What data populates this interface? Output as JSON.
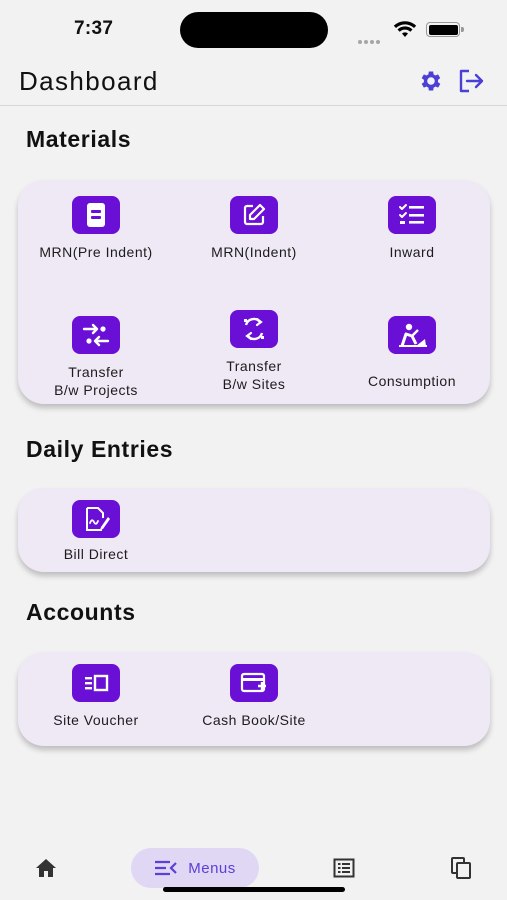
{
  "status_bar": {
    "time": "7:37"
  },
  "app_bar": {
    "title": "Dashboard",
    "settings_icon": "gear-icon",
    "logout_icon": "logout-icon"
  },
  "colors": {
    "accent": "#6a0fd6",
    "card_bg": "#efe9f6",
    "nav_active_bg": "#e0d7f5",
    "nav_active_text": "#5b3fd6",
    "icon_blue": "#4b3fd6"
  },
  "materials": {
    "title": "Materials",
    "items": [
      {
        "label": "MRN(Pre Indent)",
        "icon": "document-icon"
      },
      {
        "label": "MRN(Indent)",
        "icon": "edit-icon"
      },
      {
        "label": "Inward",
        "icon": "checklist-icon"
      },
      {
        "label": "Transfer\nB/w  Projects",
        "icon": "transfer-projects-icon"
      },
      {
        "label": "Transfer\nB/w Sites",
        "icon": "transfer-sites-icon"
      },
      {
        "label": "Consumption",
        "icon": "construction-worker-icon"
      }
    ]
  },
  "daily_entries": {
    "title": "Daily Entries",
    "items": [
      {
        "label": "Bill Direct",
        "icon": "signature-icon"
      }
    ]
  },
  "accounts": {
    "title": "Accounts",
    "items": [
      {
        "label": "Site Voucher",
        "icon": "voucher-icon"
      },
      {
        "label": "Cash Book/Site",
        "icon": "add-card-icon"
      }
    ]
  },
  "bottom_nav": {
    "items": [
      {
        "icon": "home-icon"
      },
      {
        "label": "Menus",
        "icon": "menu-icon",
        "active": true
      },
      {
        "icon": "list-icon"
      },
      {
        "icon": "copy-icon"
      }
    ]
  }
}
